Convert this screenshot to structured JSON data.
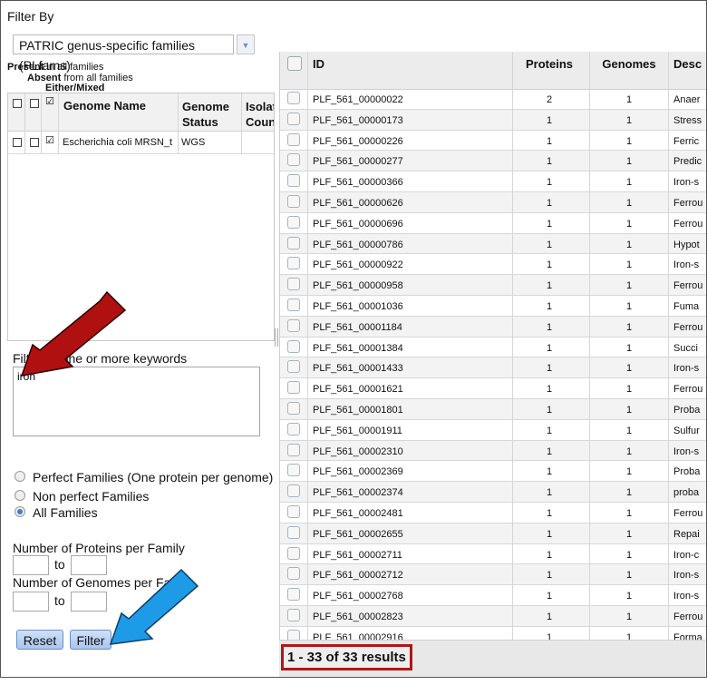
{
  "filter_panel": {
    "title": "Filter By",
    "family_select_value": "PATRIC genus-specific families (PLfams)",
    "legend": {
      "present_bold": "Present",
      "present_rest": " in all families",
      "absent_bold": "Absent",
      "absent_rest": " from all families",
      "either": "Either/Mixed"
    },
    "genome_grid": {
      "headers": {
        "name": "Genome Name",
        "status_line1": "Genome",
        "status_line2": "Status",
        "isolation_line1": "Isolati",
        "isolation_line2": "Count"
      },
      "rows": [
        {
          "name": "Escherichia coli MRSN_t",
          "status": "WGS",
          "isolation": ""
        }
      ]
    },
    "keyword_label": "Filter by one or more keywords",
    "keyword_value": "iron",
    "radio_options": [
      {
        "label": "Perfect Families (One protein per genome)",
        "selected": false
      },
      {
        "label": "Non perfect Families",
        "selected": false
      },
      {
        "label": "All Families",
        "selected": true
      }
    ],
    "proteins_label": "Number of Proteins per Family",
    "genomes_label": "Number of Genomes per Family",
    "to_label": "to",
    "reset_label": "Reset",
    "filter_label": "Filter"
  },
  "results_grid": {
    "headers": {
      "id": "ID",
      "proteins": "Proteins",
      "genomes": "Genomes",
      "description": "Desc"
    },
    "rows": [
      {
        "id": "PLF_561_00000022",
        "proteins": "2",
        "genomes": "1",
        "desc": "Anaer"
      },
      {
        "id": "PLF_561_00000173",
        "proteins": "1",
        "genomes": "1",
        "desc": "Stress"
      },
      {
        "id": "PLF_561_00000226",
        "proteins": "1",
        "genomes": "1",
        "desc": "Ferric"
      },
      {
        "id": "PLF_561_00000277",
        "proteins": "1",
        "genomes": "1",
        "desc": "Predic"
      },
      {
        "id": "PLF_561_00000366",
        "proteins": "1",
        "genomes": "1",
        "desc": "Iron-s"
      },
      {
        "id": "PLF_561_00000626",
        "proteins": "1",
        "genomes": "1",
        "desc": "Ferrou"
      },
      {
        "id": "PLF_561_00000696",
        "proteins": "1",
        "genomes": "1",
        "desc": "Ferrou"
      },
      {
        "id": "PLF_561_00000786",
        "proteins": "1",
        "genomes": "1",
        "desc": "Hypot"
      },
      {
        "id": "PLF_561_00000922",
        "proteins": "1",
        "genomes": "1",
        "desc": "Iron-s"
      },
      {
        "id": "PLF_561_00000958",
        "proteins": "1",
        "genomes": "1",
        "desc": "Ferrou"
      },
      {
        "id": "PLF_561_00001036",
        "proteins": "1",
        "genomes": "1",
        "desc": "Fuma"
      },
      {
        "id": "PLF_561_00001184",
        "proteins": "1",
        "genomes": "1",
        "desc": "Ferrou"
      },
      {
        "id": "PLF_561_00001384",
        "proteins": "1",
        "genomes": "1",
        "desc": "Succi"
      },
      {
        "id": "PLF_561_00001433",
        "proteins": "1",
        "genomes": "1",
        "desc": "Iron-s"
      },
      {
        "id": "PLF_561_00001621",
        "proteins": "1",
        "genomes": "1",
        "desc": "Ferrou"
      },
      {
        "id": "PLF_561_00001801",
        "proteins": "1",
        "genomes": "1",
        "desc": "Proba"
      },
      {
        "id": "PLF_561_00001911",
        "proteins": "1",
        "genomes": "1",
        "desc": "Sulfur"
      },
      {
        "id": "PLF_561_00002310",
        "proteins": "1",
        "genomes": "1",
        "desc": "Iron-s"
      },
      {
        "id": "PLF_561_00002369",
        "proteins": "1",
        "genomes": "1",
        "desc": "Proba"
      },
      {
        "id": "PLF_561_00002374",
        "proteins": "1",
        "genomes": "1",
        "desc": "proba"
      },
      {
        "id": "PLF_561_00002481",
        "proteins": "1",
        "genomes": "1",
        "desc": "Ferrou"
      },
      {
        "id": "PLF_561_00002655",
        "proteins": "1",
        "genomes": "1",
        "desc": "Repai"
      },
      {
        "id": "PLF_561_00002711",
        "proteins": "1",
        "genomes": "1",
        "desc": "Iron-c"
      },
      {
        "id": "PLF_561_00002712",
        "proteins": "1",
        "genomes": "1",
        "desc": "Iron-s"
      },
      {
        "id": "PLF_561_00002768",
        "proteins": "1",
        "genomes": "1",
        "desc": "Iron-s"
      },
      {
        "id": "PLF_561_00002823",
        "proteins": "1",
        "genomes": "1",
        "desc": "Ferrou"
      },
      {
        "id": "PLF_561_00002916",
        "proteins": "1",
        "genomes": "1",
        "desc": "Forma"
      }
    ],
    "results_summary": "1 - 33 of 33 results"
  },
  "annotation_colors": {
    "red_arrow": "#b01010",
    "blue_arrow": "#1e9be6",
    "results_box": "#b01717"
  }
}
